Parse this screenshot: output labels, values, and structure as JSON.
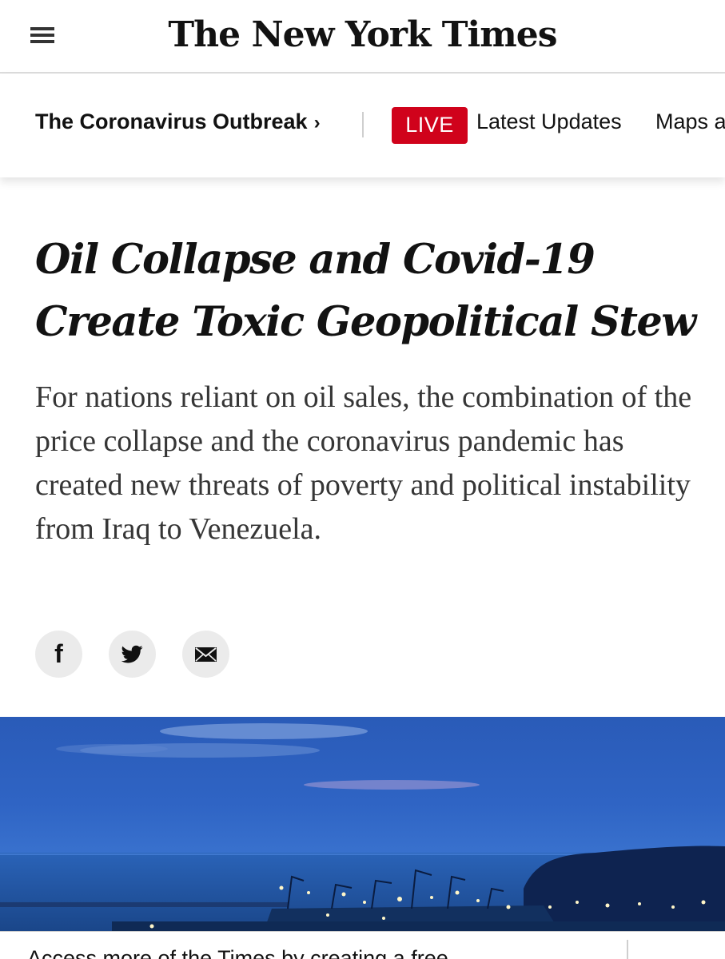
{
  "masthead": {
    "logo_text": "The New York Times",
    "menu_icon": "hamburger-menu-icon"
  },
  "nav": {
    "section_label": "The Coronavirus Outbreak",
    "chevron": "›",
    "live_label": "LIVE",
    "live_color": "#d0021b",
    "links": [
      "Latest Updates",
      "Maps a"
    ]
  },
  "article": {
    "headline_line1": "Oil Collapse and Covid-19",
    "headline_line2": "Create Toxic Geopolitical Stew",
    "summary": "For nations reliant on oil sales, the combination of the price collapse and the coronavirus pandemic has created new threats of poverty and political instability from Iraq to Venezuela."
  },
  "share": {
    "facebook_glyph": "f",
    "icons": [
      "facebook-icon",
      "twitter-icon",
      "email-icon"
    ]
  },
  "hero": {
    "description_icon": "harbor-dusk-photo"
  },
  "registration": {
    "text": "Access more of the Times by creating a free"
  }
}
